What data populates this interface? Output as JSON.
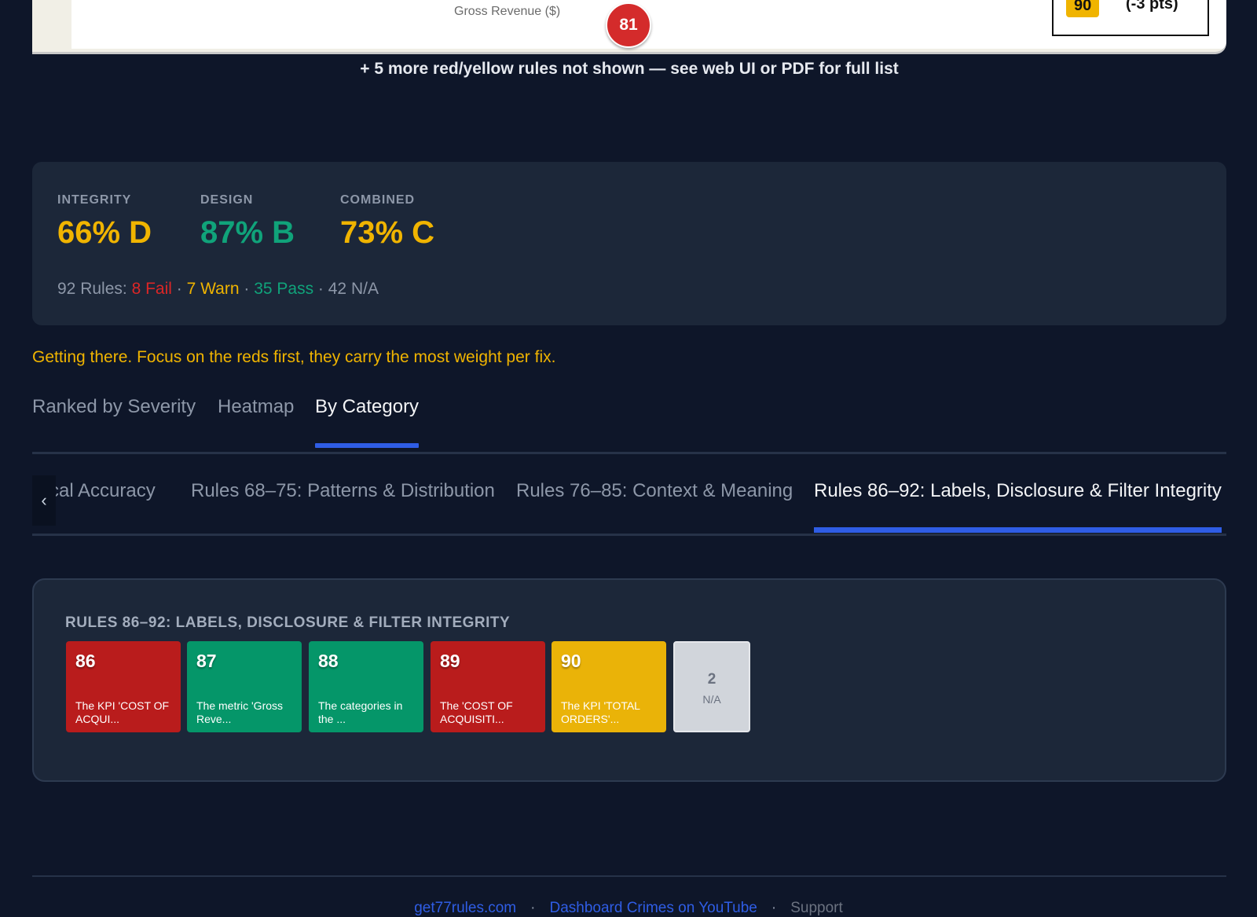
{
  "preview": {
    "axis_title": "Gross Revenue ($)",
    "marker_number": "81",
    "note_badge": "90",
    "note_text": "(-3 pts)"
  },
  "more_note": "+ 5 more red/yellow rules not shown — see web UI or PDF for full list",
  "scores": {
    "integrity": {
      "label": "INTEGRITY",
      "value": "66% D",
      "color": "#f0b400"
    },
    "design": {
      "label": "DESIGN",
      "value": "87% B",
      "color": "#10a37a"
    },
    "combined": {
      "label": "COMBINED",
      "value": "73% C",
      "color": "#f0b400"
    }
  },
  "rule_summary": {
    "prefix": "92 Rules: ",
    "fail": "8 Fail",
    "sep1": " · ",
    "warn": "7 Warn",
    "sep2": " · ",
    "pass": "35 Pass",
    "sep3": " · ",
    "na": "42 N/A"
  },
  "message": "Getting there. Focus on the reds first, they carry the most weight per fix.",
  "view_tabs": [
    {
      "label": "Ranked by Severity",
      "active": false
    },
    {
      "label": "Heatmap",
      "active": false
    },
    {
      "label": "By Category",
      "active": true
    }
  ],
  "category_tabs": [
    {
      "label": "tical Accuracy",
      "active": false
    },
    {
      "label": "Rules 68–75: Patterns & Distribution",
      "active": false
    },
    {
      "label": "Rules 76–85: Context & Meaning",
      "active": false
    },
    {
      "label": "Rules 86–92: Labels, Disclosure & Filter Integrity",
      "active": true
    }
  ],
  "panel": {
    "title": "RULES 86–92: LABELS, DISCLOSURE & FILTER INTEGRITY",
    "tiles": [
      {
        "number": "86",
        "text": "The KPI 'COST OF ACQUI...",
        "status": "fail",
        "color": "#b91c1c"
      },
      {
        "number": "87",
        "text": "The metric 'Gross Reve...",
        "status": "pass",
        "color": "#059669"
      },
      {
        "number": "88",
        "text": "The categories in the ...",
        "status": "pass",
        "color": "#059669"
      },
      {
        "number": "89",
        "text": "The 'COST OF ACQUISITI...",
        "status": "fail",
        "color": "#b91c1c"
      },
      {
        "number": "90",
        "text": "The KPI 'TOTAL ORDERS'...",
        "status": "warn",
        "color": "#eab308"
      }
    ],
    "na_count": "2",
    "na_label": "N/A"
  },
  "footer": {
    "link1": "get77rules.com",
    "sep": "·",
    "link2": "Dashboard Crimes on YouTube",
    "plain": "Support"
  }
}
